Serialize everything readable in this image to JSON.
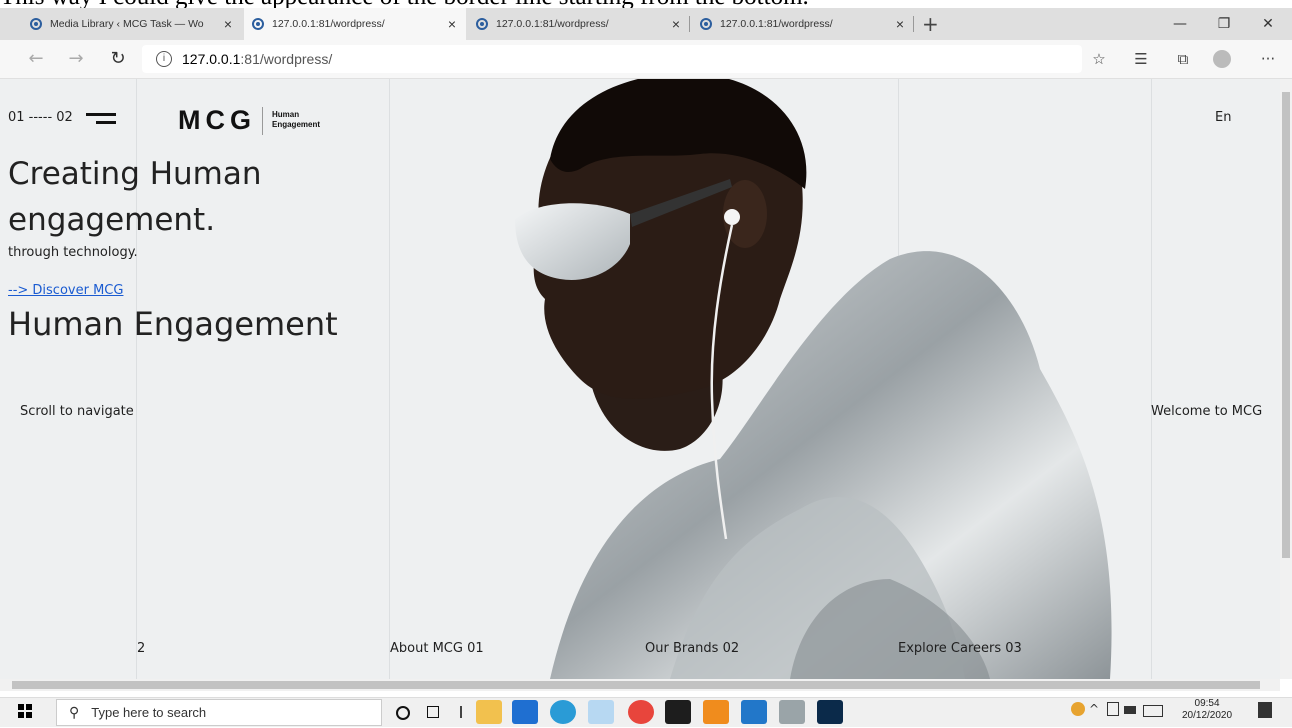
{
  "caption": "This way I could give the appearance of the border line starting from the bottom.",
  "browser": {
    "tabs": [
      {
        "title": "Media Library ‹ MCG Task — Wo",
        "active": false
      },
      {
        "title": "127.0.0.1:81/wordpress/",
        "active": true
      },
      {
        "title": "127.0.0.1:81/wordpress/",
        "active": false
      },
      {
        "title": "127.0.0.1:81/wordpress/",
        "active": false
      }
    ],
    "close_glyph": "×",
    "new_tab_glyph": "+",
    "window_controls": {
      "minimize": "—",
      "restore": "❐",
      "close": "✕"
    },
    "nav": {
      "back": "←",
      "forward": "→",
      "refresh": "↻"
    },
    "address": {
      "host": "127.0.0.1",
      "path": ":81/wordpress/",
      "info_glyph": "i"
    },
    "toolbar_icons": {
      "favorite": "☆",
      "favorites_list": "☰",
      "collections": "⧉",
      "more": "···"
    }
  },
  "page": {
    "counter": "01 ----- 02",
    "logo": "MCG",
    "logo_sub_1": "Human",
    "logo_sub_2": "Engagement",
    "language": "En",
    "headline": "Creating Human engagement.",
    "tagline": "through technology.",
    "discover_link": "--> Discover MCG",
    "subheading": "Human Engagement",
    "scroll_hint": "Scroll to navigate",
    "welcome": "Welcome to MCG",
    "nav": {
      "item_2": "2",
      "about": "About MCG 01",
      "brands": "Our Brands 02",
      "careers": "Explore Careers 03"
    }
  },
  "taskbar": {
    "search_placeholder": "Type here to search",
    "search_glyph": "⚲",
    "time": "09:54",
    "date": "20/12/2020",
    "tray_chevron": "^"
  },
  "colors": {
    "link": "#1a5bd1",
    "page_bg": "#eef0f1",
    "tab_strip": "#dfdfdf"
  }
}
